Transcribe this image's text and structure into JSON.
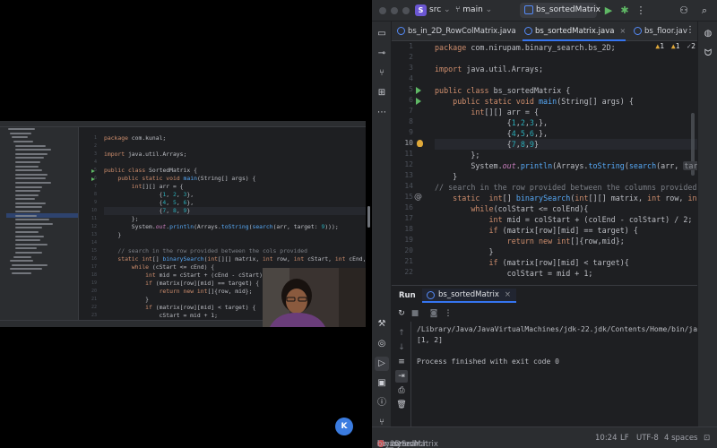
{
  "titlebar": {
    "project_badge": "S",
    "project_name": "src",
    "branch": "main",
    "run_config": "bs_sortedMatrix"
  },
  "tabs": [
    {
      "label": "bs_in_2D_RowColMatrix.java",
      "active": false
    },
    {
      "label": "bs_sortedMatrix.java",
      "active": true
    },
    {
      "label": "bs_floor.jav",
      "active": false
    }
  ],
  "editor": {
    "inspections": {
      "warnings": "1",
      "weak_warnings": "1",
      "typos": "2"
    },
    "line_numbers": [
      "1",
      "2",
      "3",
      "4",
      "5",
      "6",
      "7",
      "8",
      "9",
      "10",
      "11",
      "12",
      "13",
      "14",
      "15",
      "16",
      "17",
      "18",
      "19",
      "20",
      "21",
      "22"
    ],
    "current_line": "10",
    "lines": [
      "package com.nirupam.binary_search.bs_2D;",
      "",
      "import java.util.Arrays;",
      "",
      "public class bs_sortedMatrix {",
      "    public static void main(String[] args) {",
      "        int[][] arr = {",
      "                {1,2,3,},",
      "                {4,5,6,},",
      "                {7,8,9}",
      "        };",
      "        System.out.println(Arrays.toString(search(arr,",
      "    }",
      "// search in the row provided between the columns provided",
      "    static  int[] binarySearch(int[][] matrix, int row, int colStart",
      "        while(colStart <= colEnd){",
      "            int mid = colStart + (colEnd - colStart) / 2;",
      "            if (matrix[row][mid] == target) {",
      "                return new int[]{row,mid};",
      "            }",
      "            if (matrix[row][mid] < target){",
      "                colStart = mid + 1;"
    ],
    "hint_target": "target:",
    "hint_value": "6",
    "hint_tail": "));"
  },
  "run": {
    "label": "Run",
    "tab": "bs_sortedMatrix",
    "console": [
      "/Library/Java/JavaVirtualMachines/jdk-22.jdk/Contents/Home/bin/java -jav",
      "[1, 2]",
      "",
      "Process finished with exit code 0"
    ]
  },
  "statusbar": {
    "crumb1": "ary_search",
    "crumb2": "bs_2D",
    "crumb3": "bs_sortedMatrix",
    "crumb4": "binarySearch",
    "position": "10:24",
    "line_sep": "LF",
    "encoding": "UTF-8",
    "indent": "4 spaces"
  },
  "video": {
    "lines": [
      "package com.kunal;",
      "",
      "import java.util.Arrays;",
      "",
      "public class SortedMatrix {",
      "    public static void main(String[] args) {",
      "        int[][] arr = {",
      "                {1, 2, 3},",
      "                {4, 5, 6},",
      "                {7, 8, 9}",
      "        };",
      "        System.out.println(Arrays.toString(search(arr, target: 9)));",
      "    }",
      "",
      "    // search in the row provided between the cols provided",
      "    static int[] binarySearch(int[][] matrix, int row, int cStart, int cEnd, int ta",
      "        while (cStart <= cEnd) {",
      "            int mid = cStart + (cEnd - cStart) / 2;",
      "            if (matrix[row][mid] == target) {",
      "                return new int[]{row, mid};",
      "            }",
      "            if (matrix[row][mid] < target) {",
      "                cStart = mid + 1;"
    ]
  },
  "logo": "K"
}
